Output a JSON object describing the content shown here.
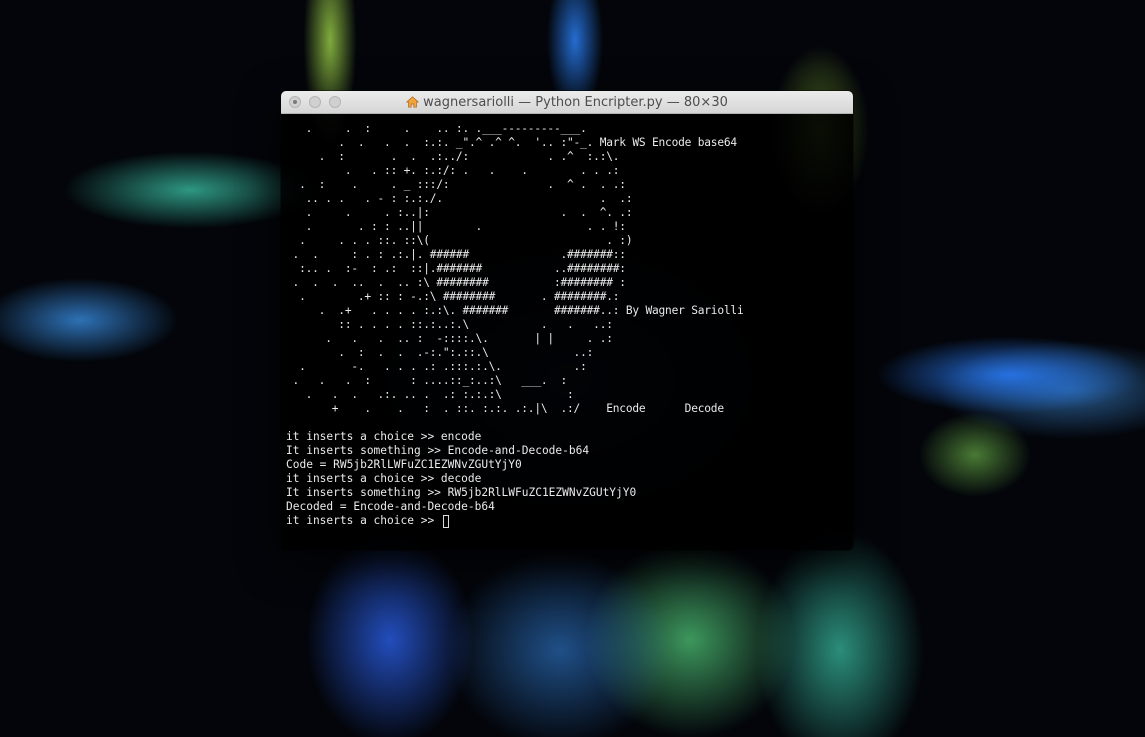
{
  "window": {
    "title": "wagnersariolli — Python Encripter.py — 80×30",
    "title_icon": "home-icon",
    "buttons": [
      "close",
      "minimize",
      "zoom"
    ]
  },
  "terminal": {
    "art": [
      "   .     .  :     .    .. :. .___---------___.",
      "        .  .   .  .  :.:. _\".^ .^ ^.  '.. :\"-_. Mark WS Encode base64",
      "     .  :       .  .  .:../:            . .^  :.:\\.",
      "         .   . :: +. :.:/: .   .    .        . . .:",
      "  .  :    .     . _ :::/:               .  ^ .  . .:",
      "   .. . .   . - : :.:./.                        .  .:",
      "   .     .     . :..|:                    .  .  ^. .:",
      "   .       . : : ..||        .                . . !:",
      "  .     . . . ::. ::\\(                           . :)",
      " .  .     : . : .:.|. ######              .#######::",
      "  :.. .  :-  : .:  ::|.#######           ..########:",
      " .  .  .  ..  .  .. :\\ ########          :######## :",
      "  .        .+ :: : -.:\\ ########       . ########.:",
      "     .  .+   . . . . :.:\\. #######       #######..: By Wagner Sariolli",
      "        :: . . . . ::.:..:.\\           .   .   ..:",
      "      .   .   .  .. :  -::::.\\.       | |     . .:",
      "        .  :  .  .  .-:.\":.::.\\             ..:",
      "  .       -.   . . . .: .:::.:.\\.           .:",
      " .   .   .  :      : ....::_:..:\\   ___.  :",
      "   .   .  .   .:. .. .  .: :.:.:\\          :",
      "       +    .    .   :  . ::. :.:. .:.|\\  .:/    Encode      Decode"
    ],
    "session": [
      "it inserts a choice >> encode",
      "It inserts something >> Encode-and-Decode-b64",
      "Code = RW5jb2RlLWFuZC1EZWNvZGUtYjY0",
      "it inserts a choice >> decode",
      "It inserts something >> RW5jb2RlLWFuZC1EZWNvZGUtYjY0",
      "Decoded = Encode-and-Decode-b64"
    ],
    "prompt": "it inserts a choice >> ",
    "input_value": ""
  },
  "colors": {
    "terminal_bg": "#000000",
    "terminal_text": "#eaeaea",
    "titlebar": "#e2e2e2"
  }
}
